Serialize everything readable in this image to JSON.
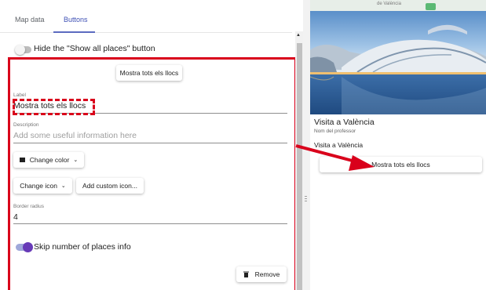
{
  "tabs": [
    {
      "label": "Map data"
    },
    {
      "label": "Buttons"
    }
  ],
  "hide_toggle": {
    "label": "Hide the \"Show all places\" button",
    "checked": false
  },
  "preview_button": {
    "label": "Mostra tots els llocs"
  },
  "label_field": {
    "label": "Label",
    "value": "Mostra tots els llocs"
  },
  "description_field": {
    "label": "Description",
    "placeholder": "Add some useful information here",
    "value": ""
  },
  "change_color": {
    "label": "Change color"
  },
  "change_icon": {
    "label": "Change icon"
  },
  "add_custom_icon": {
    "label": "Add custom icon..."
  },
  "border_radius": {
    "label": "Border radius",
    "value": "4"
  },
  "skip_toggle": {
    "label": "Skip number of places info",
    "checked": true
  },
  "remove_button": {
    "label": "Remove"
  },
  "map": {
    "attribution": "de València"
  },
  "card": {
    "title": "Visita a València",
    "subtitle": "Nom del professor",
    "line": "Visita a València",
    "button_label": "Mostra tots els llocs"
  },
  "colors": {
    "accent": "#5c6bc0",
    "toggle_on": "#673ab7",
    "annotation_red": "#d9001b"
  },
  "icons": [
    "square-icon",
    "chevron-down-icon",
    "trash-icon",
    "drag-handle-icon",
    "scroll-up-icon"
  ]
}
